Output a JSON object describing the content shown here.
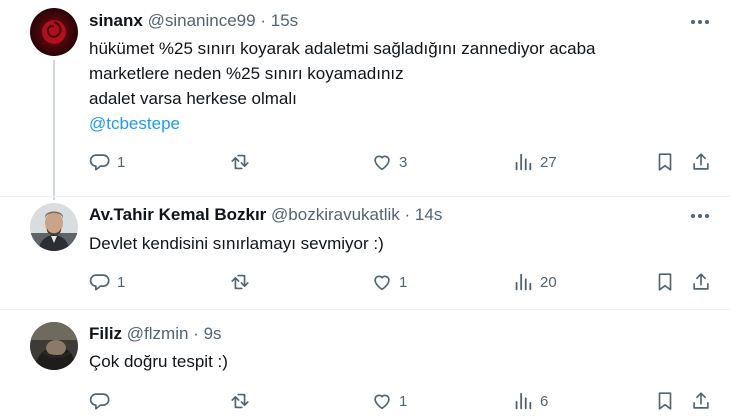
{
  "tweets": [
    {
      "name": "sinanx",
      "handle": "@sinanince99",
      "separator": "·",
      "time": "15s",
      "lines": [
        "hükümet %25 sınırı koyarak adaletmi sağladığını zannediyor acaba",
        "marketlere neden %25 sınırı koyamadınız",
        "adalet varsa herkese olmalı"
      ],
      "mention": "@tcbestepe",
      "reply_count": "1",
      "retweet_count": "",
      "like_count": "3",
      "view_count": "27"
    },
    {
      "name": "Av.Tahir Kemal Bozkır",
      "handle": "@bozkiravukatlik",
      "separator": "·",
      "time": "14s",
      "lines": [
        "Devlet kendisini sınırlamayı sevmiyor :)"
      ],
      "reply_count": "1",
      "retweet_count": "",
      "like_count": "1",
      "view_count": "20"
    },
    {
      "name": "Filiz",
      "handle": "@flzmin",
      "separator": "·",
      "time": "9s",
      "lines": [
        "Çok doğru tespit :)"
      ],
      "reply_count": "",
      "retweet_count": "",
      "like_count": "1",
      "view_count": "6"
    }
  ],
  "icons": {
    "reply": "reply-icon",
    "retweet": "retweet-icon",
    "like": "like-icon",
    "views": "views-icon",
    "bookmark": "bookmark-icon",
    "share": "share-icon",
    "more": "more-icon"
  },
  "colors": {
    "text": "#0f1419",
    "secondary": "#536471",
    "mention": "#1d9bf0",
    "thread_line": "#cfd9de"
  }
}
